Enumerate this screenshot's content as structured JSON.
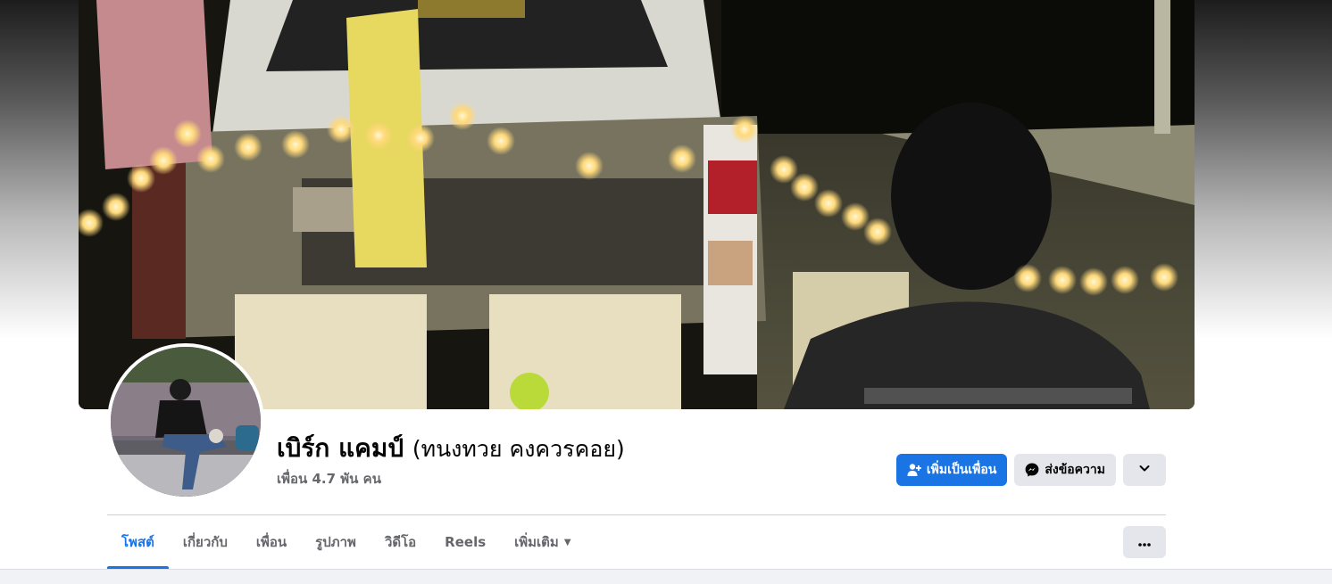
{
  "profile": {
    "name": "เบิร์ก แคมป์",
    "alternate_name": "(ทนงทวย คงควรคอย)",
    "friends_count": "เพื่อน 4.7 พัน คน"
  },
  "actions": {
    "add_friend": "เพิ่มเป็นเพื่อน",
    "message": "ส่งข้อความ"
  },
  "tabs": [
    {
      "label": "โพสต์",
      "active": true
    },
    {
      "label": "เกี่ยวกับ",
      "active": false
    },
    {
      "label": "เพื่อน",
      "active": false
    },
    {
      "label": "รูปภาพ",
      "active": false
    },
    {
      "label": "วิดีโอ",
      "active": false
    },
    {
      "label": "Reels",
      "active": false
    },
    {
      "label": "เพิ่มเติม",
      "active": false
    }
  ],
  "icons": {
    "add_friend": "person-plus-icon",
    "message": "messenger-icon",
    "dropdown": "chevron-down-icon",
    "more_tab": "caret-down-icon",
    "more": "ellipsis-icon"
  },
  "colors": {
    "accent": "#1b74e4",
    "secondary_button": "#e4e6eb",
    "muted_text": "#65676b"
  }
}
